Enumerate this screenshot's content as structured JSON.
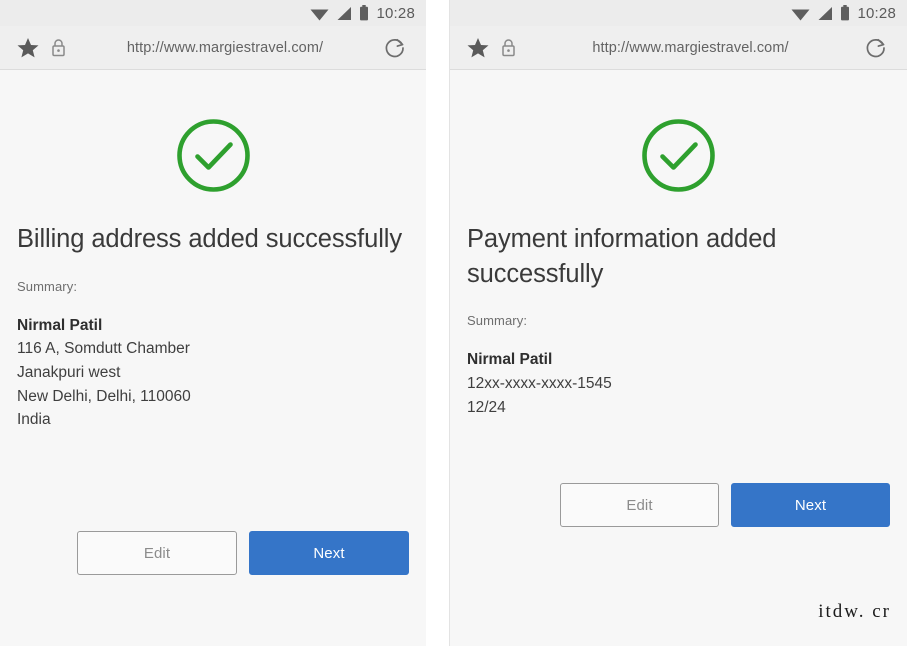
{
  "statusbar": {
    "time": "10:28",
    "icons": [
      "wifi-icon",
      "cellular-signal-icon",
      "battery-icon"
    ]
  },
  "browser": {
    "url": "http://www.margiestravel.com/",
    "icons": [
      "star-icon",
      "lock-icon",
      "reload-icon"
    ]
  },
  "colors": {
    "success_green": "#2ea02e",
    "primary_blue": "#3575c8",
    "page_background": "#f7f7f7",
    "chrome_background": "#efefef"
  },
  "screens": [
    {
      "id": "billing-address-confirmation",
      "status_icon": "check-circle-icon",
      "headline": "Billing address added successfully",
      "summary_label": "Summary:",
      "summary": {
        "name": "Nirmal Patil",
        "lines": [
          "116 A, Somdutt Chamber",
          "Janakpuri west",
          "New Delhi, Delhi, 110060",
          "India"
        ]
      },
      "buttons": {
        "secondary": "Edit",
        "primary": "Next"
      }
    },
    {
      "id": "payment-information-confirmation",
      "status_icon": "check-circle-icon",
      "headline": "Payment information added successfully",
      "summary_label": "Summary:",
      "summary": {
        "name": "Nirmal Patil",
        "lines": [
          "12xx-xxxx-xxxx-1545",
          "12/24"
        ]
      },
      "buttons": {
        "secondary": "Edit",
        "primary": "Next"
      }
    }
  ],
  "watermark": "itdw. cr"
}
